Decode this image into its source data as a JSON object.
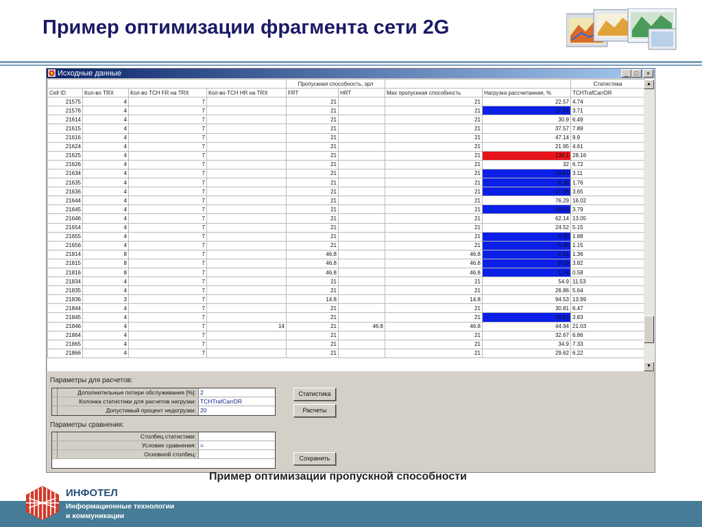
{
  "slide": {
    "title": "Пример оптимизации фрагмента сети 2G",
    "caption": "Пример оптимизации пропускной способности"
  },
  "window": {
    "title": "Исходные данные",
    "controls": [
      "_",
      "□",
      "×"
    ]
  },
  "grid": {
    "group_headers": {
      "throughput": "Пропускная способность, эрл",
      "statistics": "Статистика"
    },
    "columns": [
      "Cell ID",
      "Кол-во TRX",
      "Кол-во TCH FR на TRX",
      "Кол-во TCH HR на TRX",
      "FRT",
      "HRT",
      "Max пропускная способность",
      "Нагрузка рассчитанная, %",
      "TCHTrafCarrDR"
    ],
    "rows": [
      {
        "id": "21575",
        "trx": "4",
        "fr": "7",
        "hr": "",
        "frt": "21",
        "hrt": "",
        "max": "21",
        "load": "22.57",
        "stat": "4.74",
        "hl": ""
      },
      {
        "id": "21576",
        "trx": "4",
        "fr": "7",
        "hr": "",
        "frt": "21",
        "hrt": "",
        "max": "21",
        "load": "17.67",
        "stat": "3.71",
        "hl": "blue"
      },
      {
        "id": "21614",
        "trx": "4",
        "fr": "7",
        "hr": "",
        "frt": "21",
        "hrt": "",
        "max": "21",
        "load": "30.9",
        "stat": "6.49",
        "hl": ""
      },
      {
        "id": "21615",
        "trx": "4",
        "fr": "7",
        "hr": "",
        "frt": "21",
        "hrt": "",
        "max": "21",
        "load": "37.57",
        "stat": "7.89",
        "hl": ""
      },
      {
        "id": "21616",
        "trx": "4",
        "fr": "7",
        "hr": "",
        "frt": "21",
        "hrt": "",
        "max": "21",
        "load": "47.14",
        "stat": "9.9",
        "hl": ""
      },
      {
        "id": "21624",
        "trx": "4",
        "fr": "7",
        "hr": "",
        "frt": "21",
        "hrt": "",
        "max": "21",
        "load": "21.95",
        "stat": "4.61",
        "hl": ""
      },
      {
        "id": "21625",
        "trx": "4",
        "fr": "7",
        "hr": "",
        "frt": "21",
        "hrt": "",
        "max": "21",
        "load": "134.1",
        "stat": "28.16",
        "hl": "red"
      },
      {
        "id": "21626",
        "trx": "4",
        "fr": "7",
        "hr": "",
        "frt": "21",
        "hrt": "",
        "max": "21",
        "load": "32",
        "stat": "6.72",
        "hl": ""
      },
      {
        "id": "21634",
        "trx": "4",
        "fr": "7",
        "hr": "",
        "frt": "21",
        "hrt": "",
        "max": "21",
        "load": "14.81",
        "stat": "3.11",
        "hl": "blue"
      },
      {
        "id": "21635",
        "trx": "4",
        "fr": "7",
        "hr": "",
        "frt": "21",
        "hrt": "",
        "max": "21",
        "load": "8.38",
        "stat": "1.76",
        "hl": "blue"
      },
      {
        "id": "21636",
        "trx": "4",
        "fr": "7",
        "hr": "",
        "frt": "21",
        "hrt": "",
        "max": "21",
        "load": "17.38",
        "stat": "3.65",
        "hl": "blue"
      },
      {
        "id": "21644",
        "trx": "4",
        "fr": "7",
        "hr": "",
        "frt": "21",
        "hrt": "",
        "max": "21",
        "load": "76.29",
        "stat": "16.02",
        "hl": ""
      },
      {
        "id": "21645",
        "trx": "4",
        "fr": "7",
        "hr": "",
        "frt": "21",
        "hrt": "",
        "max": "21",
        "load": "18.05",
        "stat": "3.79",
        "hl": "blue"
      },
      {
        "id": "21646",
        "trx": "4",
        "fr": "7",
        "hr": "",
        "frt": "21",
        "hrt": "",
        "max": "21",
        "load": "62.14",
        "stat": "13.05",
        "hl": ""
      },
      {
        "id": "21654",
        "trx": "4",
        "fr": "7",
        "hr": "",
        "frt": "21",
        "hrt": "",
        "max": "21",
        "load": "24.52",
        "stat": "5.15",
        "hl": ""
      },
      {
        "id": "21655",
        "trx": "4",
        "fr": "7",
        "hr": "",
        "frt": "21",
        "hrt": "",
        "max": "21",
        "load": "8.95",
        "stat": "1.88",
        "hl": "blue"
      },
      {
        "id": "21656",
        "trx": "4",
        "fr": "7",
        "hr": "",
        "frt": "21",
        "hrt": "",
        "max": "21",
        "load": "5.48",
        "stat": "1.15",
        "hl": "blue"
      },
      {
        "id": "21814",
        "trx": "8",
        "fr": "7",
        "hr": "",
        "frt": "46.8",
        "hrt": "",
        "max": "46.8",
        "load": "2.91",
        "stat": "1.36",
        "hl": "blue"
      },
      {
        "id": "21815",
        "trx": "8",
        "fr": "7",
        "hr": "",
        "frt": "46.8",
        "hrt": "",
        "max": "46.8",
        "load": "8.16",
        "stat": "3.82",
        "hl": "blue"
      },
      {
        "id": "21816",
        "trx": "8",
        "fr": "7",
        "hr": "",
        "frt": "46.8",
        "hrt": "",
        "max": "46.8",
        "load": "1.24",
        "stat": "0.58",
        "hl": "blue"
      },
      {
        "id": "21834",
        "trx": "4",
        "fr": "7",
        "hr": "",
        "frt": "21",
        "hrt": "",
        "max": "21",
        "load": "54.9",
        "stat": "11.53",
        "hl": ""
      },
      {
        "id": "21835",
        "trx": "4",
        "fr": "7",
        "hr": "",
        "frt": "21",
        "hrt": "",
        "max": "21",
        "load": "26.86",
        "stat": "5.64",
        "hl": ""
      },
      {
        "id": "21836",
        "trx": "3",
        "fr": "7",
        "hr": "",
        "frt": "14.8",
        "hrt": "",
        "max": "14.8",
        "load": "94.53",
        "stat": "13.99",
        "hl": ""
      },
      {
        "id": "21844",
        "trx": "4",
        "fr": "7",
        "hr": "",
        "frt": "21",
        "hrt": "",
        "max": "21",
        "load": "30.81",
        "stat": "6.47",
        "hl": ""
      },
      {
        "id": "21845",
        "trx": "4",
        "fr": "7",
        "hr": "",
        "frt": "21",
        "hrt": "",
        "max": "21",
        "load": "18.24",
        "stat": "3.83",
        "hl": "blue"
      },
      {
        "id": "21846",
        "trx": "4",
        "fr": "7",
        "hr": "14",
        "frt": "21",
        "hrt": "46.8",
        "max": "46.8",
        "load": "44.94",
        "stat": "21.03",
        "hl": ""
      },
      {
        "id": "21864",
        "trx": "4",
        "fr": "7",
        "hr": "",
        "frt": "21",
        "hrt": "",
        "max": "21",
        "load": "32.67",
        "stat": "6.86",
        "hl": ""
      },
      {
        "id": "21865",
        "trx": "4",
        "fr": "7",
        "hr": "",
        "frt": "21",
        "hrt": "",
        "max": "21",
        "load": "34.9",
        "stat": "7.33",
        "hl": ""
      },
      {
        "id": "21866",
        "trx": "4",
        "fr": "7",
        "hr": "",
        "frt": "21",
        "hrt": "",
        "max": "21",
        "load": "29.62",
        "stat": "6.22",
        "hl": ""
      }
    ]
  },
  "calc_params": {
    "heading": "Параметры для расчетов:",
    "rows": [
      {
        "label": "Дополнительные потери обслуживания [%]:",
        "value": "2"
      },
      {
        "label": "Колонка статистики для расчетов нагрузки:",
        "value": "TCHTrafCarrDR"
      },
      {
        "label": "Допустимый процент недогрузки:",
        "value": "20"
      }
    ]
  },
  "compare_params": {
    "heading": "Параметры сравнения:",
    "rows": [
      {
        "label": "Столбец статистики:",
        "value": ""
      },
      {
        "label": "Условие сравнения:",
        "value": "="
      },
      {
        "label": "Основной столбец:",
        "value": ""
      }
    ]
  },
  "buttons": {
    "statistics": "Статистика",
    "calculations": "Расчеты",
    "save": "Сохранить"
  },
  "footer": {
    "brand": "ИНФОТЕЛ",
    "sub_line1": "Информационные технологии",
    "sub_line2": "и коммуникации"
  },
  "colors": {
    "underload_highlight": "#0b1fe6",
    "overload_highlight": "#e8141c",
    "title_color": "#1a1a66",
    "footer_band": "#467c96"
  }
}
